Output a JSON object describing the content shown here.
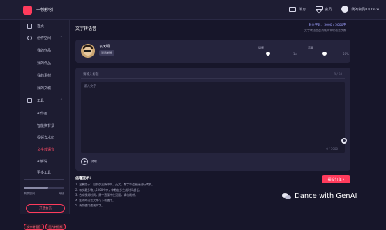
{
  "app": {
    "logo_text": "一帧秒创"
  },
  "topbar": {
    "messages_label": "消息",
    "vip_label": "会员",
    "user_label": "我的会员ID/3924"
  },
  "sidebar": {
    "home": "首页",
    "creation": "创作空间",
    "creation_items": [
      "我的作品",
      "我的作品",
      "我的素材",
      "我的文稿"
    ],
    "tools": "工具",
    "tool_items": [
      "AI作画",
      "智能换背景",
      "视频去水印",
      "文字转语音",
      "AI解说",
      "更多工具"
    ],
    "progress_fraction": 0.6,
    "row1_left": "剩余空间",
    "row1_right": "升级",
    "upgrade_label": "开通会员",
    "pill_left": "文字转语音",
    "pill_right": "图片转视频"
  },
  "main": {
    "title": "文字转语音",
    "quota": "剩余字数：5000 / 5000字",
    "quota_sub": "文字转语音会消耗文本转语音字数",
    "voice": {
      "name": "袁天明",
      "tag": "资讯新闻",
      "speed_label": "语速",
      "speed_value": "1x",
      "speed_fraction": 0.3,
      "volume_label": "音量",
      "volume_value": "50%",
      "volume_fraction": 0.5
    },
    "editor": {
      "title_placeholder": "请输入标题",
      "title_count": "0 / 50",
      "content_placeholder": "输入文字",
      "content_count": "0 / 5000",
      "listen_label": "试听"
    },
    "tips_title": "温馨提示：",
    "tips": [
      "1. 温馨提示：目前仅支持中文，英文、数字等会直接进行转换。",
      "2. 每次最多输入5000个字，字数越多生成时间越长。",
      "3. 合成视频时间，需一直保持在页面，请勿刷新。",
      "4. 生成的语音文件可下载使用。",
      "5. 请勿使用违规文字。"
    ],
    "submit_label": "提交订单 ›"
  },
  "watermark": {
    "text": "Dance with GenAI"
  }
}
